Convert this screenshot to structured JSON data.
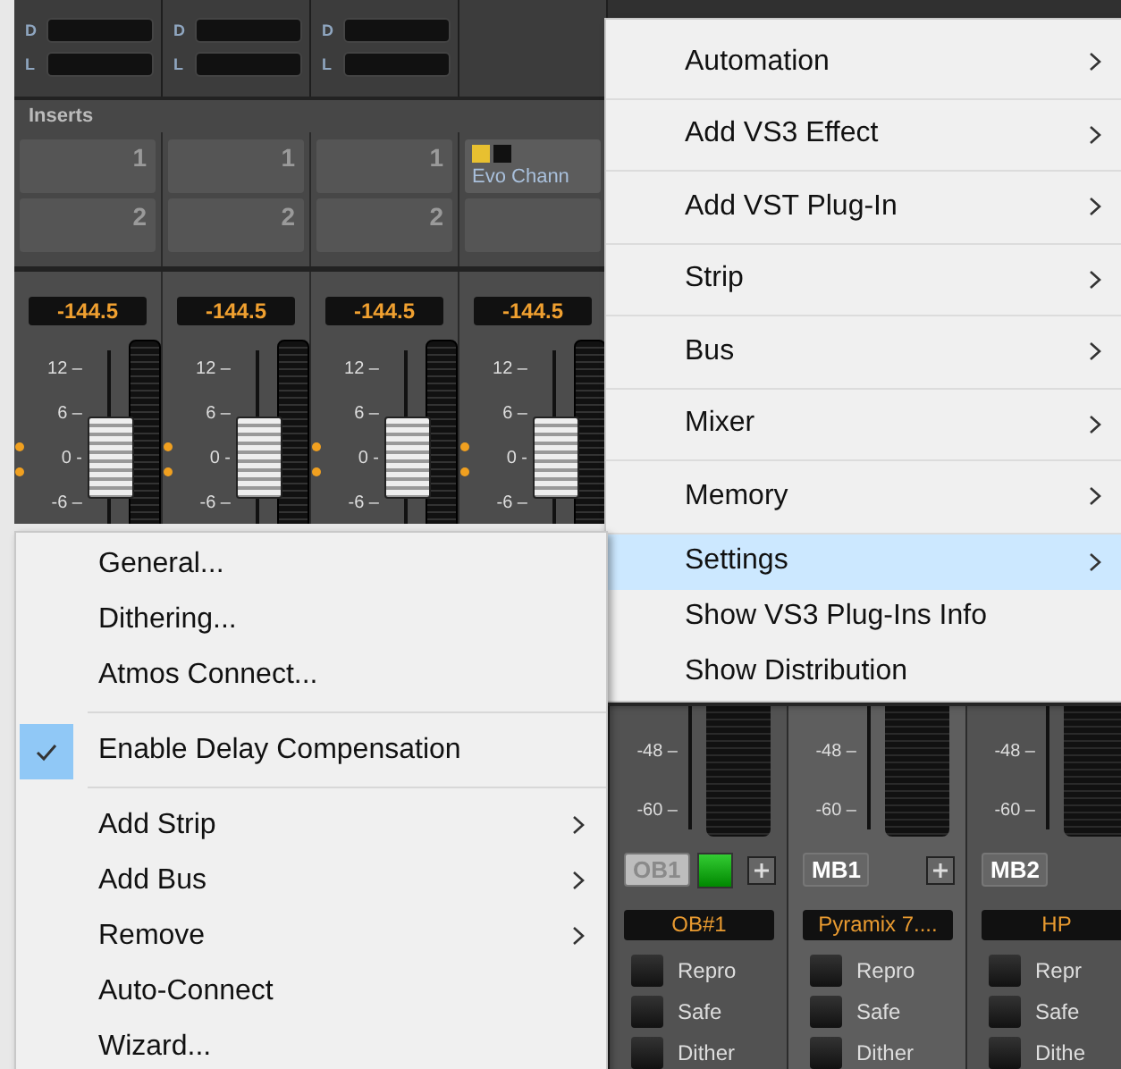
{
  "mixer": {
    "inserts_title": "Inserts",
    "strips": [
      {
        "sends": [
          "D",
          "L"
        ],
        "inserts": [
          {
            "kind": "slot",
            "number": "1"
          },
          {
            "kind": "slot",
            "number": "2"
          }
        ],
        "readout": "-144.5",
        "scale": [
          "12 –",
          "6 –",
          "0 -",
          "-6 –"
        ],
        "level": 0.35
      },
      {
        "sends": [
          "D",
          "L"
        ],
        "inserts": [
          {
            "kind": "slot",
            "number": "1"
          },
          {
            "kind": "slot",
            "number": "2"
          }
        ],
        "readout": "-144.5",
        "scale": [
          "12 –",
          "6 –",
          "0 -",
          "-6 –"
        ],
        "level": 0.35
      },
      {
        "sends": [
          "D",
          "L"
        ],
        "inserts": [
          {
            "kind": "slot",
            "number": "1"
          },
          {
            "kind": "slot",
            "number": "2"
          }
        ],
        "readout": "-144.5",
        "scale": [
          "12 –",
          "6 –",
          "0 -",
          "-6 –"
        ],
        "level": 0.35
      },
      {
        "inserts": [
          {
            "kind": "plugin",
            "name": "Evo Chann"
          },
          {
            "kind": "blank"
          }
        ],
        "readout": "-144.5",
        "scale": [
          "12 –",
          "6 –",
          "0 -",
          "-6 –"
        ],
        "level": 0.35
      }
    ],
    "busses": [
      {
        "name": "OB1",
        "enabled": false,
        "indicator_on": true,
        "add_button": true,
        "selected": false,
        "label": "OB#1",
        "scale": [
          "-48 –",
          "-60 –"
        ],
        "buttons": [
          "Repro",
          "Safe",
          "Dither"
        ]
      },
      {
        "name": "MB1",
        "enabled": true,
        "indicator_on": false,
        "add_button": true,
        "selected": true,
        "label": "Pyramix 7....",
        "scale": [
          "-48 –",
          "-60 –"
        ],
        "buttons": [
          "Repro",
          "Safe",
          "Dither"
        ]
      },
      {
        "name": "MB2",
        "enabled": true,
        "indicator_on": false,
        "add_button": false,
        "selected": false,
        "label": "HP",
        "scale": [
          "-48 –",
          "-60 –"
        ],
        "buttons": [
          "Repr",
          "Safe",
          "Dithe"
        ]
      }
    ]
  },
  "context_menu": {
    "items": [
      {
        "label": "Automation",
        "submenu": true,
        "selected": false,
        "divider_below": true
      },
      {
        "label": "Add VS3 Effect",
        "submenu": true,
        "selected": false,
        "divider_below": true
      },
      {
        "label": "Add VST Plug-In",
        "submenu": true,
        "selected": false,
        "divider_below": true
      },
      {
        "label": "Strip",
        "submenu": true,
        "selected": false,
        "divider_below": true
      },
      {
        "label": "Bus",
        "submenu": true,
        "selected": false,
        "divider_below": true
      },
      {
        "label": "Mixer",
        "submenu": true,
        "selected": false,
        "divider_below": true
      },
      {
        "label": "Memory",
        "submenu": true,
        "selected": false,
        "divider_below": true
      },
      {
        "label": "Settings",
        "submenu": true,
        "selected": true,
        "divider_below": false
      },
      {
        "label": "Show VS3 Plug-Ins Info",
        "submenu": false,
        "selected": false,
        "divider_below": false
      },
      {
        "label": "Show Distribution",
        "submenu": false,
        "selected": false,
        "divider_below": false
      }
    ]
  },
  "settings_submenu": {
    "items": [
      {
        "kind": "item",
        "label": "General...",
        "submenu": false,
        "checked": false
      },
      {
        "kind": "item",
        "label": "Dithering...",
        "submenu": false,
        "checked": false
      },
      {
        "kind": "item",
        "label": "Atmos Connect...",
        "submenu": false,
        "checked": false
      },
      {
        "kind": "separator"
      },
      {
        "kind": "item",
        "label": "Enable Delay Compensation",
        "submenu": false,
        "checked": true
      },
      {
        "kind": "separator"
      },
      {
        "kind": "item",
        "label": "Add Strip",
        "submenu": true,
        "checked": false
      },
      {
        "kind": "item",
        "label": "Add Bus",
        "submenu": true,
        "checked": false
      },
      {
        "kind": "item",
        "label": "Remove",
        "submenu": true,
        "checked": false
      },
      {
        "kind": "item",
        "label": "Auto-Connect",
        "submenu": false,
        "checked": false
      },
      {
        "kind": "item",
        "label": "Wizard...",
        "submenu": false,
        "checked": false
      }
    ]
  }
}
